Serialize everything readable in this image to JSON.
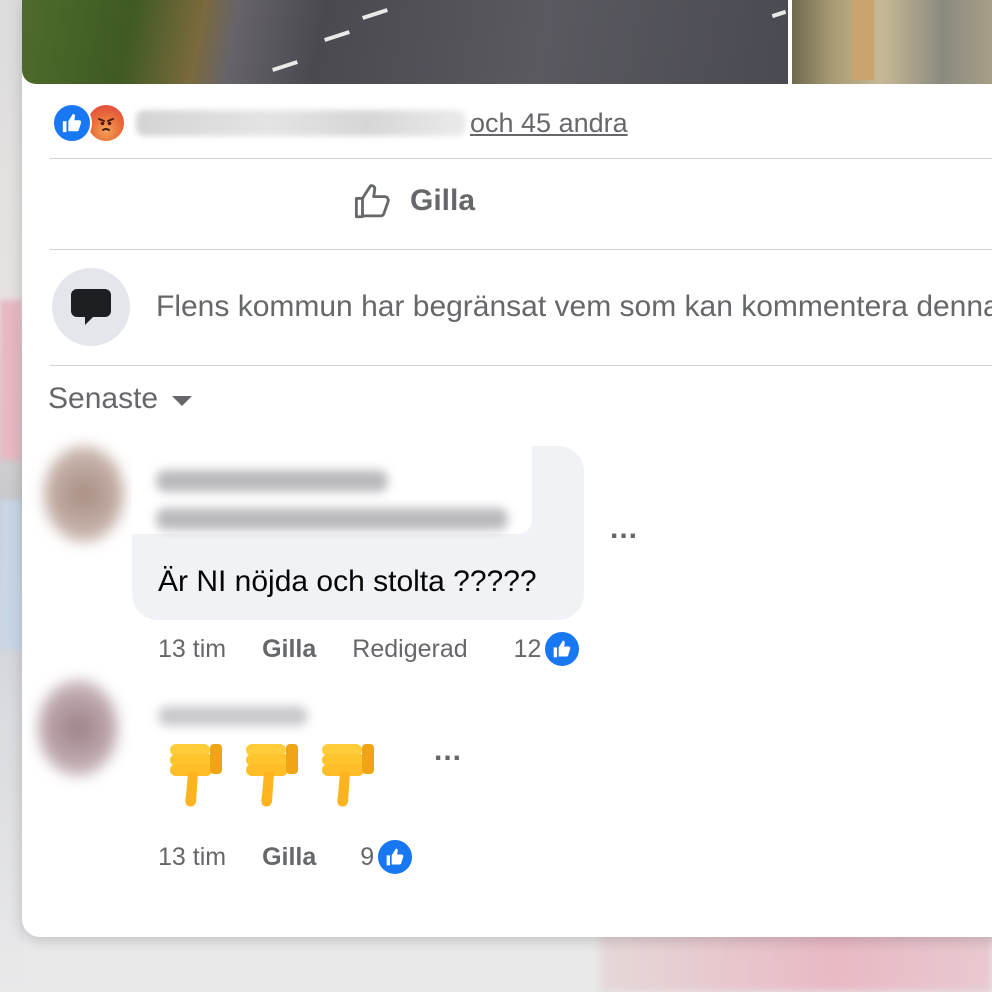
{
  "post": {
    "reactions": {
      "icons": [
        "like-icon",
        "angry-icon"
      ],
      "others_text": "och 45 andra"
    },
    "actions": {
      "like_label": "Gilla"
    },
    "restriction_text": "Flens kommun har begränsat vem som kan kommentera denna post",
    "sort_label": "Senaste"
  },
  "comments": [
    {
      "text": "Är NI nöjda och stolta ?????",
      "time": "13 tim",
      "like_label": "Gilla",
      "edited_label": "Redigerad",
      "like_count": "12",
      "more": "..."
    },
    {
      "emoji": [
        "thumbs-down-icon",
        "thumbs-down-icon",
        "thumbs-down-icon"
      ],
      "time": "13 tim",
      "like_label": "Gilla",
      "like_count": "9",
      "more": "..."
    }
  ],
  "colors": {
    "accent": "#1877f2",
    "muted_text": "#65676b",
    "bubble": "#f0f2f5",
    "divider": "#ced0d4"
  }
}
